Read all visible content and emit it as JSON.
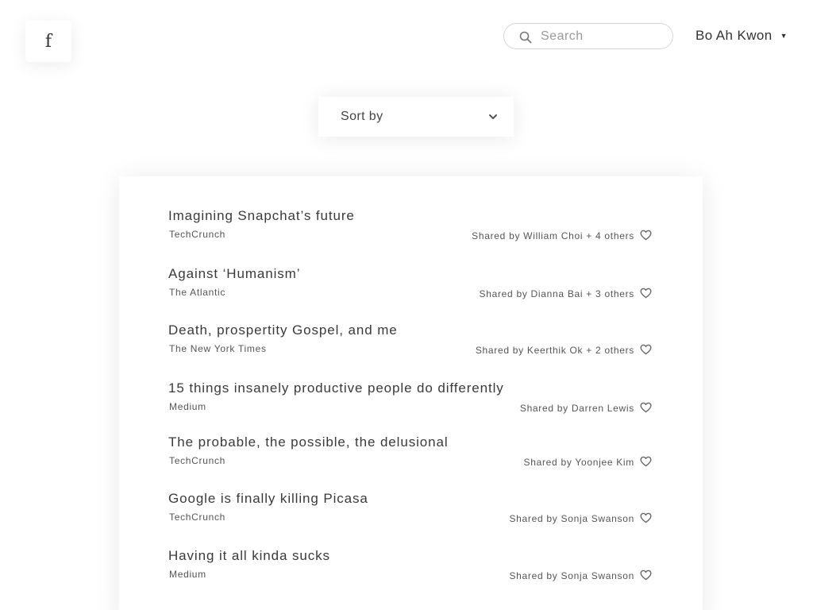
{
  "logo": {
    "letter": "f"
  },
  "search": {
    "placeholder": "Search",
    "value": ""
  },
  "user": {
    "name": "Bo Ah Kwon",
    "caret": "▼"
  },
  "sort": {
    "label": "Sort by"
  },
  "feed": {
    "items": [
      {
        "title": "Imagining Snapchat’s future",
        "source": "TechCrunch",
        "shared": "Shared by William Choi + 4 others"
      },
      {
        "title": "Against ‘Humanism’",
        "source": "The Atlantic",
        "shared": "Shared by Dianna Bai + 3 others"
      },
      {
        "title": "Death, prospertity Gospel, and me",
        "source": "The New York Times",
        "shared": "Shared by Keerthik Ok + 2 others"
      },
      {
        "title": "15 things insanely productive people do differently",
        "source": "Medium",
        "shared": "Shared by Darren Lewis"
      },
      {
        "title": "The probable, the possible, the delusional",
        "source": "TechCrunch",
        "shared": "Shared by Yoonjee Kim"
      },
      {
        "title": "Google is finally killing Picasa",
        "source": "TechCrunch",
        "shared": "Shared by Sonja Swanson"
      },
      {
        "title": "Having it all kinda sucks",
        "source": "Medium",
        "shared": "Shared by Sonja Swanson"
      }
    ]
  },
  "icons": {
    "search": "search-icon",
    "heart": "heart-icon",
    "chevron": "chevron-down-icon",
    "caret": "caret-down-icon"
  },
  "colors": {
    "text": "#444444",
    "border": "#d6d6d6",
    "background": "#ffffff"
  }
}
